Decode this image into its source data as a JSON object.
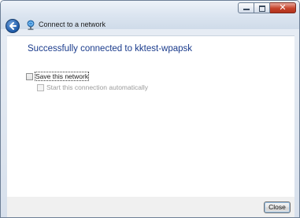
{
  "window": {
    "title": "Connect to a network",
    "close_glyph": "✕"
  },
  "content": {
    "heading": "Successfully connected to kktest-wpapsk",
    "save_network": {
      "label": "Save this network",
      "checked": false
    },
    "start_automatically": {
      "label": "Start this connection automatically",
      "checked": false,
      "enabled": false
    }
  },
  "footer": {
    "close_label": "Close"
  },
  "icons": {
    "back": "back-arrow-icon",
    "network": "network-icon",
    "minimize": "minimize-icon",
    "maximize": "maximize-icon",
    "close": "close-icon"
  },
  "colors": {
    "heading": "#1a3b8c",
    "close_button": "#c5432b"
  }
}
